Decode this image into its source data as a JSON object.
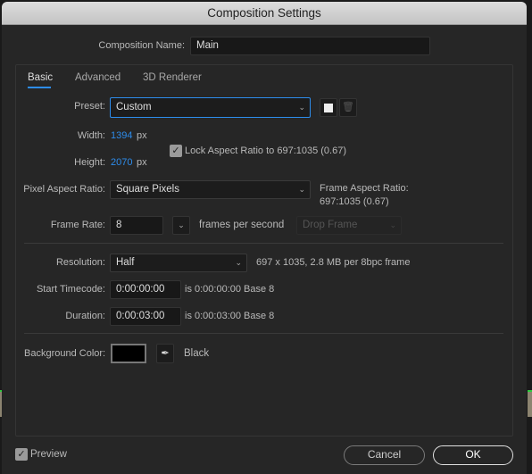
{
  "window": {
    "title": "Composition Settings"
  },
  "comp_name": {
    "label": "Composition Name:",
    "value": "Main"
  },
  "tabs": [
    {
      "label": "Basic",
      "active": true
    },
    {
      "label": "Advanced"
    },
    {
      "label": "3D Renderer"
    }
  ],
  "preset": {
    "label": "Preset:",
    "value": "Custom"
  },
  "width": {
    "label": "Width:",
    "value": "1394",
    "unit": "px"
  },
  "height": {
    "label": "Height:",
    "value": "2070",
    "unit": "px"
  },
  "lock": {
    "label": "Lock Aspect Ratio to 697:1035 (0.67)",
    "checked": true
  },
  "par": {
    "label": "Pixel Aspect Ratio:",
    "value": "Square Pixels",
    "far_label": "Frame Aspect Ratio:",
    "far_value": "697:1035 (0.67)"
  },
  "frame_rate": {
    "label": "Frame Rate:",
    "value": "8",
    "unit": "frames per second",
    "drop_frame": "Drop Frame"
  },
  "resolution": {
    "label": "Resolution:",
    "value": "Half",
    "info": "697 x 1035, 2.8 MB per 8bpc frame"
  },
  "start_tc": {
    "label": "Start Timecode:",
    "value": "0:00:00:00",
    "info": "is 0:00:00:00  Base 8"
  },
  "duration": {
    "label": "Duration:",
    "value": "0:00:03:00",
    "info": "is 0:00:03:00  Base 8"
  },
  "bg": {
    "label": "Background Color:",
    "name": "Black",
    "color": "#000000"
  },
  "footer": {
    "preview": "Preview",
    "preview_checked": true,
    "cancel": "Cancel",
    "ok": "OK"
  },
  "colors": {
    "accent": "#2d8ceb"
  }
}
